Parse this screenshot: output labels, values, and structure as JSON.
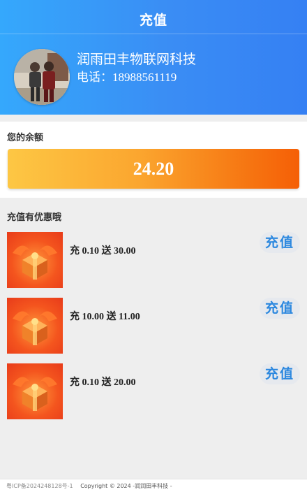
{
  "header": {
    "title": "充值",
    "company_name": "润雨田丰物联网科技",
    "phone_label": "电话：",
    "phone_number": "18988561119"
  },
  "balance": {
    "label": "您的余额",
    "amount": "24.20"
  },
  "promotions": {
    "title": "充值有优惠哦",
    "items": [
      {
        "text": "充 0.10 送 30.00",
        "button": "充值"
      },
      {
        "text": "充 10.00 送 11.00",
        "button": "充值"
      },
      {
        "text": "充 0.10 送 20.00",
        "button": "充值"
      }
    ]
  },
  "footer": {
    "icp": "粤ICP备2024248128号-1",
    "copyright": "Copyright © 2024 -润润田丰科技 -"
  },
  "colors": {
    "header_gradient_start": "#35a8fc",
    "header_gradient_end": "#3580f3",
    "balance_gradient_start": "#fdc744",
    "balance_gradient_end": "#f55f06",
    "button_text": "#2c88df"
  },
  "icons": {
    "avatar": "user-photo",
    "offer_image": "gift-box-icon"
  }
}
